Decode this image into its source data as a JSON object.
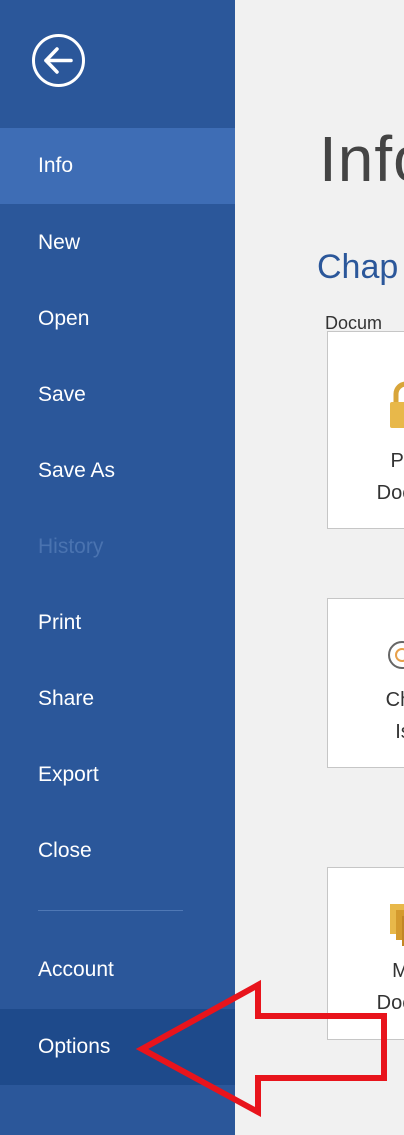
{
  "nav": {
    "items": [
      {
        "label": "Info",
        "state": "active"
      },
      {
        "label": "New",
        "state": "normal"
      },
      {
        "label": "Open",
        "state": "normal"
      },
      {
        "label": "Save",
        "state": "normal"
      },
      {
        "label": "Save As",
        "state": "normal"
      },
      {
        "label": "History",
        "state": "disabled"
      },
      {
        "label": "Print",
        "state": "normal"
      },
      {
        "label": "Share",
        "state": "normal"
      },
      {
        "label": "Export",
        "state": "normal"
      },
      {
        "label": "Close",
        "state": "normal"
      },
      {
        "label": "Account",
        "state": "normal"
      },
      {
        "label": "Options",
        "state": "selected"
      }
    ]
  },
  "main": {
    "title": "Info",
    "section_title": "Chap",
    "section_sublabel": "Docum",
    "cards": [
      {
        "icon": "lock-icon",
        "line1": "Pro",
        "line2": "Docu"
      },
      {
        "icon": "inspect-icon",
        "line1": "Che",
        "line2": "Iss"
      },
      {
        "icon": "manage-versions-icon",
        "line1": "Ma",
        "line2": "Docu"
      }
    ]
  },
  "colors": {
    "sidebar": "#2b579a",
    "active_item": "#3e6db5",
    "selected_item": "#1e4a8b",
    "annotation_arrow": "#e8141c"
  }
}
